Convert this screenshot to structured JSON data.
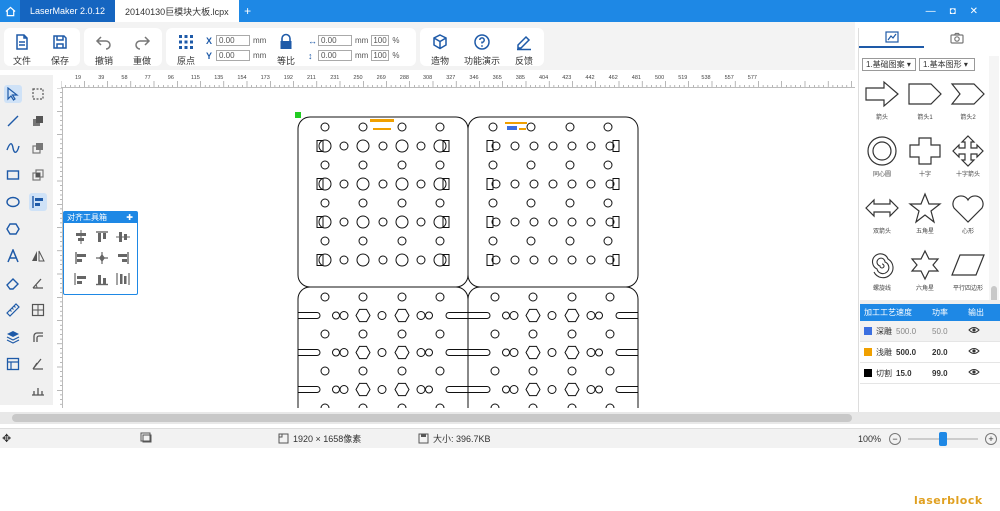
{
  "titlebar": {
    "app_title": "LaserMaker 2.0.12",
    "doc_tab": "20140130巨模块大板.lcpx",
    "new_tab": "+",
    "minimize": "—",
    "maximize": "◘",
    "close": "✕"
  },
  "toolbar": {
    "file": "文件",
    "save": "保存",
    "undo": "撤销",
    "redo": "重做",
    "origin": "原点",
    "x_label": "X",
    "y_label": "Y",
    "x_value": "0.00",
    "y_value": "0.00",
    "unit": "mm",
    "width_value": "0.00",
    "height_value": "0.00",
    "width_pct": "100",
    "height_pct": "100",
    "pct": "%",
    "ratio": "等比",
    "build": "造物",
    "demo": "功能演示",
    "feedback": "反馈"
  },
  "ruler": {
    "labels": [
      "19",
      "39",
      "58",
      "77",
      "96",
      "115",
      "135",
      "154",
      "173",
      "192",
      "211",
      "231",
      "250",
      "269",
      "288",
      "308",
      "327",
      "346",
      "365",
      "385",
      "404",
      "423",
      "442",
      "462",
      "481",
      "500",
      "519",
      "538",
      "557",
      "577"
    ]
  },
  "align_palette": {
    "title": "对齐工具箱",
    "pin": "📌"
  },
  "shapes_panel": {
    "category": "1.基础图案",
    "subcategory": "1.基本图形",
    "items": [
      "箭头",
      "箭头1",
      "箭头2",
      "同心圆",
      "十字",
      "十字箭头",
      "双箭头",
      "五角星",
      "心形",
      "螺旋线",
      "六角星",
      "平行四边形"
    ]
  },
  "layers": {
    "headers": [
      "加工工艺",
      "速度",
      "功率",
      "输出"
    ],
    "rows": [
      {
        "color": "#3b6fe0",
        "mode": "深雕",
        "speed": "500.0",
        "power": "50.0"
      },
      {
        "color": "#f0a000",
        "mode": "浅雕",
        "speed": "500.0",
        "power": "20.0"
      },
      {
        "color": "#000000",
        "mode": "切割",
        "speed": "15.0",
        "power": "99.0"
      }
    ]
  },
  "status": {
    "dimensions": "1920 × 1658像素",
    "size": "大小: 396.7KB",
    "zoom": "100%",
    "zoom_out": "−",
    "zoom_in": "+"
  },
  "logo": "laserblock"
}
